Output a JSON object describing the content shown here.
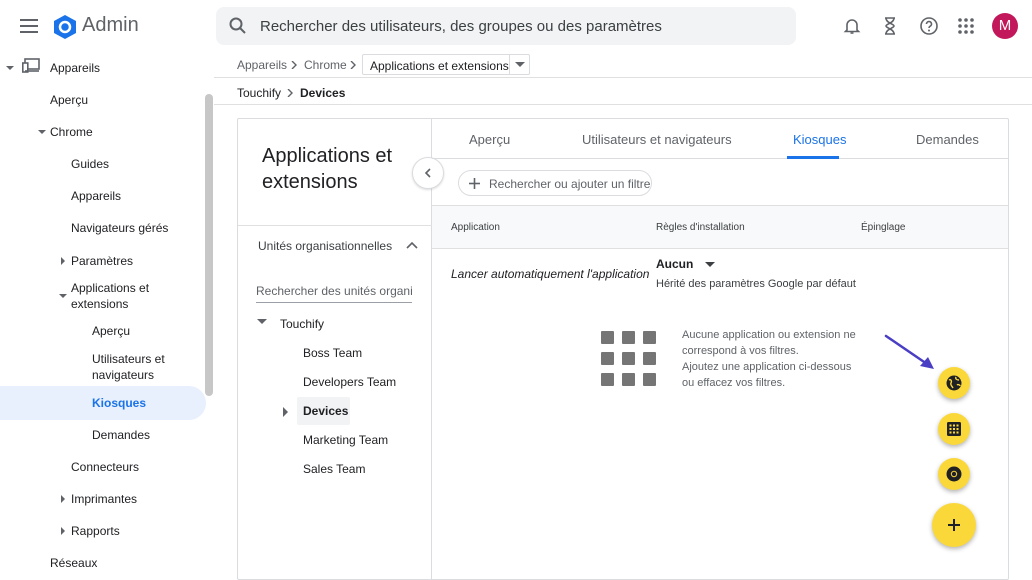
{
  "header": {
    "brand": "Admin",
    "search_placeholder": "Rechercher des utilisateurs, des groupes ou des paramètres",
    "avatar_letter": "M"
  },
  "sidebar": {
    "appareils": "Appareils",
    "apercu": "Aperçu",
    "chrome": "Chrome",
    "guides": "Guides",
    "appareils_sub": "Appareils",
    "navigateurs": "Navigateurs gérés",
    "parametres": "Paramètres",
    "apps_line1": "Applications et",
    "apps_line2": "extensions",
    "apps_apercu": "Aperçu",
    "users_line1": "Utilisateurs et",
    "users_line2": "navigateurs",
    "kiosques": "Kiosques",
    "demandes": "Demandes",
    "connecteurs": "Connecteurs",
    "imprimantes": "Imprimantes",
    "rapports": "Rapports",
    "reseaux": "Réseaux"
  },
  "breadcrumb": {
    "level1": "Appareils",
    "level2": "Chrome",
    "level3": "Applications et extensions",
    "org1": "Touchify",
    "org2": "Devices"
  },
  "left_panel": {
    "title": "Applications et extensions",
    "ou_title": "Unités organisationnelles",
    "ou_search_placeholder": "Rechercher des unités organisationnelles",
    "tree": {
      "root": "Touchify",
      "n1": "Boss Team",
      "n2": "Developers Team",
      "n3": "Devices",
      "n4": "Marketing Team",
      "n5": "Sales Team"
    }
  },
  "tabs": {
    "t1": "Aperçu",
    "t2": "Utilisateurs et navigateurs",
    "t3": "Kiosques",
    "t4": "Demandes"
  },
  "filter": {
    "label": "Rechercher ou ajouter un filtre"
  },
  "table": {
    "col_app": "Application",
    "col_rules": "Règles d'installation",
    "col_pin": "Épinglage",
    "row_app": "Lancer automatiquement l'application",
    "row_rule": "Aucun",
    "row_inherit": "Hérité des paramètres Google par défaut"
  },
  "empty_state": {
    "line1": "Aucune application ou extension ne",
    "line2": "correspond à vos filtres.",
    "line3": "Ajoutez une application ci-dessous",
    "line4": "ou effacez vos filtres."
  },
  "colors": {
    "accent": "#1a73e8",
    "fab": "#fbd83a",
    "avatar": "#c2185b",
    "arrow": "#4a3fc4"
  }
}
